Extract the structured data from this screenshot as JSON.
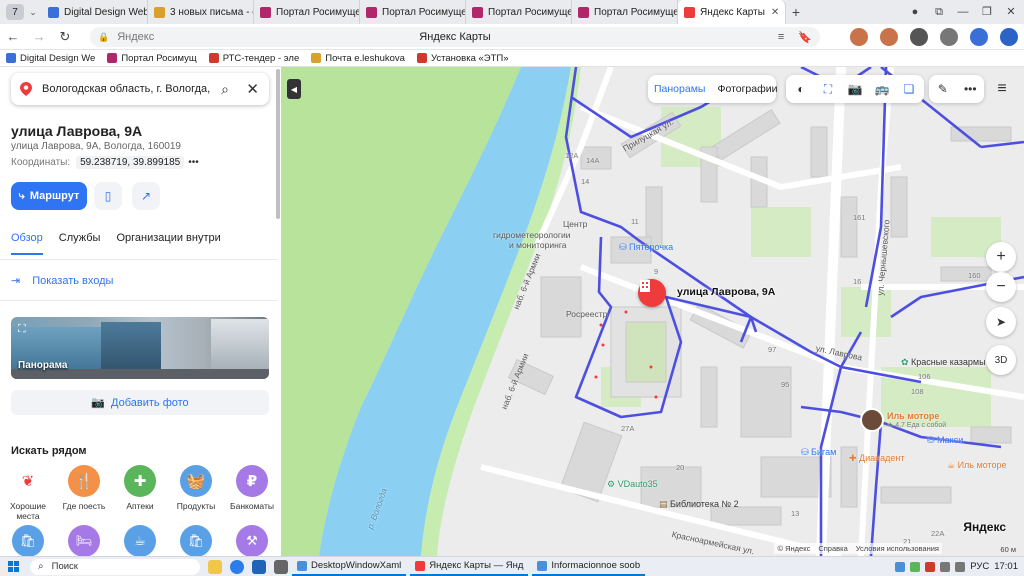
{
  "browser": {
    "tab_counter": "7",
    "tabs": [
      {
        "label": "Digital Design Web",
        "color": "#3b6fd8"
      },
      {
        "label": "3 новых письма - e",
        "color": "#d8a030"
      },
      {
        "label": "Портал Росимуще",
        "color": "#b0276a"
      },
      {
        "label": "Портал Росимуще",
        "color": "#b0276a"
      },
      {
        "label": "Портал Росимуще",
        "color": "#b0276a"
      },
      {
        "label": "Портал Росимуще",
        "color": "#b0276a"
      },
      {
        "label": "Яндекс Карты",
        "color": "#ef3b3b"
      }
    ],
    "address_host": "Яндекс",
    "page_title": "Яндекс Карты",
    "bookmarks": [
      {
        "label": "Digital Design We",
        "color": "#3b6fd8"
      },
      {
        "label": "Портал Росимущ",
        "color": "#b0276a"
      },
      {
        "label": "РТС-тендер - эле",
        "color": "#d03a2a"
      },
      {
        "label": "Почта e.leshukova",
        "color": "#d8a030"
      },
      {
        "label": "Установка «ЭТП»",
        "color": "#d03a2a"
      }
    ]
  },
  "sidebar": {
    "search_query": "Вологодская область, г. Вологда, ул. Лаврова, 9А",
    "title": "улица Лаврова, 9А",
    "address": "улица Лаврова, 9А, Вологда, 160019",
    "coords_label": "Координаты:",
    "coords_value": "59.238719, 39.899185",
    "coords_more": "•••",
    "route_label": "Маршрут",
    "tabs": [
      "Обзор",
      "Службы",
      "Организации внутри"
    ],
    "entrances": "Показать входы",
    "panorama": "Панорама",
    "add_photo": "Добавить фото",
    "nearby_title": "Искать рядом",
    "nearby": [
      {
        "label": "Хорошие места",
        "color": "#ffffff",
        "glyph": "❦"
      },
      {
        "label": "Где поесть",
        "color": "#f29147",
        "glyph": "🍴"
      },
      {
        "label": "Аптеки",
        "color": "#5bb55b",
        "glyph": "✚"
      },
      {
        "label": "Продукты",
        "color": "#5aa0e6",
        "glyph": "🧺"
      },
      {
        "label": "Банкоматы",
        "color": "#a57ae6",
        "glyph": "₽"
      }
    ],
    "nearby_row2": [
      {
        "color": "#5aa0e6",
        "glyph": "🛍"
      },
      {
        "color": "#a57ae6",
        "glyph": "🛏"
      },
      {
        "color": "#5aa0e6",
        "glyph": "☕"
      },
      {
        "color": "#5aa0e6",
        "glyph": "🛍"
      },
      {
        "color": "#a57ae6",
        "glyph": "⚒"
      }
    ]
  },
  "map": {
    "panoramas": "Панорамы",
    "photos": "Фотографии",
    "marker_label": "улица Лаврова, 9А",
    "pyaterochka": "Пятёрочка",
    "center_label_1": "Центр",
    "center_label_2": "гидрометеорологии",
    "center_label_3": "и мониторинга",
    "rosreestr": "Росреестр",
    "krasnye": "Красные казармы",
    "il_motore": "Иль моторе",
    "il_motore_sub": "★ 4,7 Еда с собой",
    "maksi": "Макси",
    "bigam": "Бигам",
    "dianadent": "Дианадент",
    "il_motore_2": "Иль моторе",
    "vdauto": "VDauto35",
    "biblioteka": "Библиотека № 2",
    "river": "р. Вологда",
    "copyright": "© Яндекс",
    "help": "Справка",
    "terms": "Условия использования",
    "scale": "60 м",
    "yandex": "Яндекс",
    "btn_3d": "3D",
    "street_labels": {
      "pr6": "наб. 6-й Армии",
      "lavrova": "ул. Лаврова",
      "chernyshevskogo": "ул. Чернышевского",
      "krasnoarm": "Красноармейская ул.",
      "prilutskaya": "Прилуцкая ул."
    },
    "house_numbers": [
      "12А",
      "14А",
      "14",
      "11",
      "9",
      "97",
      "161",
      "16",
      "106",
      "108",
      "95",
      "160",
      "27А",
      "13",
      "20",
      "21",
      "22А"
    ]
  },
  "taskbar": {
    "search": "Поиск",
    "apps": [
      {
        "label": "DesktopWindowXaml",
        "color": "#4a90d9"
      },
      {
        "label": "Яндекс Карты — Янд",
        "color": "#ef3b3b"
      },
      {
        "label": "Informacionnoe soob",
        "color": "#4a90d9"
      }
    ],
    "lang": "РУС",
    "time": "17:01"
  }
}
